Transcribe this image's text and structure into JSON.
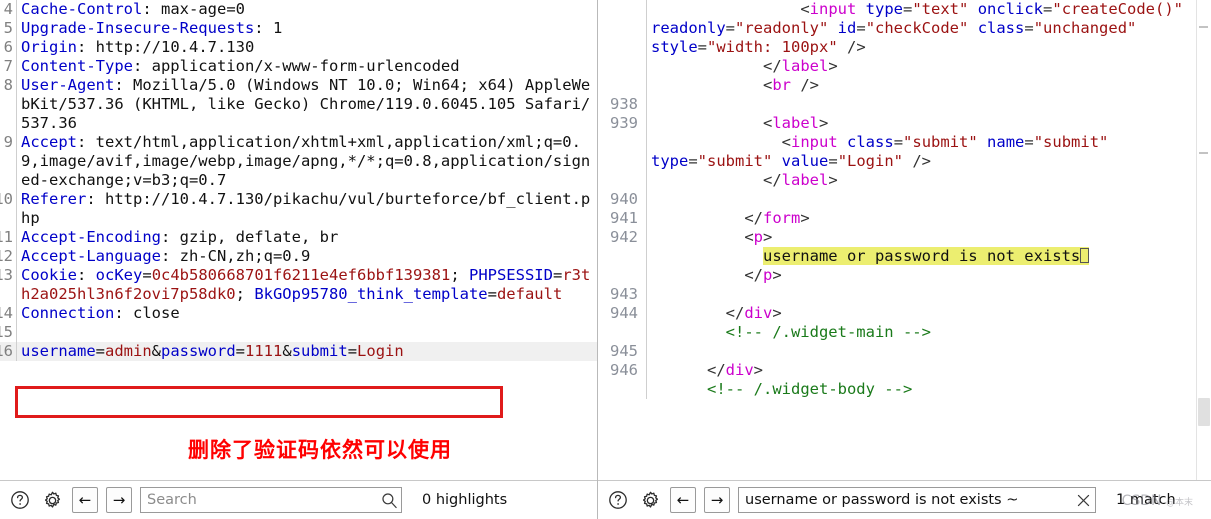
{
  "left_panel": {
    "name": "http-request-viewer",
    "lines": [
      {
        "num": "4",
        "segments": [
          {
            "t": "Cache-Control",
            "c": "k"
          },
          {
            "t": ": max-age=0",
            "c": "v"
          }
        ]
      },
      {
        "num": "5",
        "segments": [
          {
            "t": "Upgrade-Insecure-Requests",
            "c": "k"
          },
          {
            "t": ": 1",
            "c": "v"
          }
        ]
      },
      {
        "num": "6",
        "segments": [
          {
            "t": "Origin",
            "c": "k"
          },
          {
            "t": ": http://10.4.7.130",
            "c": "v"
          }
        ]
      },
      {
        "num": "7",
        "segments": [
          {
            "t": "Content-Type",
            "c": "k"
          },
          {
            "t": ": application/x-www-form-urlencoded",
            "c": "v"
          }
        ]
      },
      {
        "num": "8",
        "segments": [
          {
            "t": "User-Agent",
            "c": "k"
          },
          {
            "t": ": Mozilla/5.0 (Windows NT 10.0; Win64; x64) AppleWebKit/537.36 (KHTML, like Gecko) Chrome/119.0.6045.105 Safari/537.36",
            "c": "v"
          }
        ]
      },
      {
        "num": "9",
        "segments": [
          {
            "t": "Accept",
            "c": "k"
          },
          {
            "t": ": text/html,application/xhtml+xml,application/xml;q=0.9,image/avif,image/webp,image/apng,*/*;q=0.8,application/signed-exchange;v=b3;q=0.7",
            "c": "v"
          }
        ]
      },
      {
        "num": "10",
        "segments": [
          {
            "t": "Referer",
            "c": "k"
          },
          {
            "t": ": http://10.4.7.130/pikachu/vul/burteforce/bf_client.php",
            "c": "v"
          }
        ]
      },
      {
        "num": "11",
        "segments": [
          {
            "t": "Accept-Encoding",
            "c": "k"
          },
          {
            "t": ": gzip, deflate, br",
            "c": "v"
          }
        ]
      },
      {
        "num": "12",
        "segments": [
          {
            "t": "Accept-Language",
            "c": "k"
          },
          {
            "t": ": zh-CN,zh;q=0.9",
            "c": "v"
          }
        ]
      },
      {
        "num": "13",
        "segments": [
          {
            "t": "Cookie",
            "c": "k"
          },
          {
            "t": ": ",
            "c": "v"
          },
          {
            "t": "ocKey",
            "c": "k"
          },
          {
            "t": "=",
            "c": "v"
          },
          {
            "t": "0c4b580668701f6211e4ef6bbf139381",
            "c": "rv"
          },
          {
            "t": "; ",
            "c": "v"
          },
          {
            "t": "PHPSESSID",
            "c": "k"
          },
          {
            "t": "=",
            "c": "v"
          },
          {
            "t": "r3th2a025hl3n6f2ovi7p58dk0",
            "c": "rv"
          },
          {
            "t": "; ",
            "c": "v"
          },
          {
            "t": "BkGOp95780_think_template",
            "c": "k"
          },
          {
            "t": "=",
            "c": "v"
          },
          {
            "t": "default",
            "c": "rv"
          }
        ]
      },
      {
        "num": "14",
        "segments": [
          {
            "t": "Connection",
            "c": "k"
          },
          {
            "t": ": close",
            "c": "v"
          }
        ]
      },
      {
        "num": "15",
        "segments": [
          {
            "t": "",
            "c": "v"
          }
        ]
      },
      {
        "num": "16",
        "highlight": true,
        "segments": [
          {
            "t": "username",
            "c": "k"
          },
          {
            "t": "=",
            "c": "v"
          },
          {
            "t": "admin",
            "c": "rv"
          },
          {
            "t": "&",
            "c": "v"
          },
          {
            "t": "password",
            "c": "k"
          },
          {
            "t": "=",
            "c": "v"
          },
          {
            "t": "1111",
            "c": "rv"
          },
          {
            "t": "&",
            "c": "v"
          },
          {
            "t": "submit",
            "c": "k"
          },
          {
            "t": "=",
            "c": "v"
          },
          {
            "t": "Login",
            "c": "rv"
          }
        ]
      }
    ],
    "annotation": "删除了验证码依然可以使用",
    "annotation_color": "#ff0000",
    "redbox_color": "#e01b1b"
  },
  "right_panel": {
    "name": "http-response-viewer",
    "lines": [
      {
        "num": "",
        "segments": [
          {
            "t": "                ",
            "c": "punc"
          },
          {
            "t": "<",
            "c": "punc"
          },
          {
            "t": "input",
            "c": "tag"
          },
          {
            "t": " ",
            "c": "punc"
          },
          {
            "t": "type",
            "c": "attr"
          },
          {
            "t": "=",
            "c": "punc"
          },
          {
            "t": "\"text\"",
            "c": "str"
          },
          {
            "t": " ",
            "c": "punc"
          },
          {
            "t": "onclick",
            "c": "attr"
          },
          {
            "t": "=",
            "c": "punc"
          },
          {
            "t": "\"createCode()\"",
            "c": "str"
          },
          {
            "t": " ",
            "c": "punc"
          },
          {
            "t": "readonly",
            "c": "attr"
          },
          {
            "t": "=",
            "c": "punc"
          },
          {
            "t": "\"readonly\"",
            "c": "str"
          },
          {
            "t": " ",
            "c": "punc"
          },
          {
            "t": "id",
            "c": "attr"
          },
          {
            "t": "=",
            "c": "punc"
          },
          {
            "t": "\"checkCode\"",
            "c": "str"
          },
          {
            "t": " ",
            "c": "punc"
          },
          {
            "t": "class",
            "c": "attr"
          },
          {
            "t": "=",
            "c": "punc"
          },
          {
            "t": "\"unchanged\"",
            "c": "str"
          },
          {
            "t": " ",
            "c": "punc"
          },
          {
            "t": "style",
            "c": "attr"
          },
          {
            "t": "=",
            "c": "punc"
          },
          {
            "t": "\"width: 100px\"",
            "c": "str"
          },
          {
            "t": " />",
            "c": "punc"
          }
        ]
      },
      {
        "num": "",
        "segments": [
          {
            "t": "            ",
            "c": "punc"
          },
          {
            "t": "</",
            "c": "punc"
          },
          {
            "t": "label",
            "c": "tag"
          },
          {
            "t": ">",
            "c": "punc"
          }
        ]
      },
      {
        "num": "",
        "segments": [
          {
            "t": "            ",
            "c": "punc"
          },
          {
            "t": "<",
            "c": "punc"
          },
          {
            "t": "br",
            "c": "tag"
          },
          {
            "t": " />",
            "c": "punc"
          }
        ]
      },
      {
        "num": "938",
        "segments": [
          {
            "t": "",
            "c": "punc"
          }
        ]
      },
      {
        "num": "939",
        "segments": [
          {
            "t": "            ",
            "c": "punc"
          },
          {
            "t": "<",
            "c": "punc"
          },
          {
            "t": "label",
            "c": "tag"
          },
          {
            "t": ">",
            "c": "punc"
          }
        ]
      },
      {
        "num": "",
        "segments": [
          {
            "t": "              ",
            "c": "punc"
          },
          {
            "t": "<",
            "c": "punc"
          },
          {
            "t": "input",
            "c": "tag"
          },
          {
            "t": " ",
            "c": "punc"
          },
          {
            "t": "class",
            "c": "attr"
          },
          {
            "t": "=",
            "c": "punc"
          },
          {
            "t": "\"submit\"",
            "c": "str"
          },
          {
            "t": " ",
            "c": "punc"
          },
          {
            "t": "name",
            "c": "attr"
          },
          {
            "t": "=",
            "c": "punc"
          },
          {
            "t": "\"submit\"",
            "c": "str"
          },
          {
            "t": " ",
            "c": "punc"
          },
          {
            "t": "type",
            "c": "attr"
          },
          {
            "t": "=",
            "c": "punc"
          },
          {
            "t": "\"submit\"",
            "c": "str"
          },
          {
            "t": " ",
            "c": "punc"
          },
          {
            "t": "value",
            "c": "attr"
          },
          {
            "t": "=",
            "c": "punc"
          },
          {
            "t": "\"Login\"",
            "c": "str"
          },
          {
            "t": " />",
            "c": "punc"
          }
        ]
      },
      {
        "num": "",
        "segments": [
          {
            "t": "            ",
            "c": "punc"
          },
          {
            "t": "</",
            "c": "punc"
          },
          {
            "t": "label",
            "c": "tag"
          },
          {
            "t": ">",
            "c": "punc"
          }
        ]
      },
      {
        "num": "940",
        "segments": [
          {
            "t": "",
            "c": "punc"
          }
        ]
      },
      {
        "num": "941",
        "segments": [
          {
            "t": "          ",
            "c": "punc"
          },
          {
            "t": "</",
            "c": "punc"
          },
          {
            "t": "form",
            "c": "tag"
          },
          {
            "t": ">",
            "c": "punc"
          }
        ]
      },
      {
        "num": "942",
        "segments": [
          {
            "t": "          ",
            "c": "punc"
          },
          {
            "t": "<",
            "c": "punc"
          },
          {
            "t": "p",
            "c": "tag"
          },
          {
            "t": ">",
            "c": "punc"
          }
        ]
      },
      {
        "num": "",
        "segments": [
          {
            "t": "            ",
            "c": "punc"
          },
          {
            "t": "username or password is not exists",
            "c": "mark"
          },
          {
            "t": "\u0001",
            "c": "mark-tofu"
          }
        ]
      },
      {
        "num": "",
        "segments": [
          {
            "t": "          ",
            "c": "punc"
          },
          {
            "t": "</",
            "c": "punc"
          },
          {
            "t": "p",
            "c": "tag"
          },
          {
            "t": ">",
            "c": "punc"
          }
        ]
      },
      {
        "num": "943",
        "segments": [
          {
            "t": "",
            "c": "punc"
          }
        ]
      },
      {
        "num": "944",
        "segments": [
          {
            "t": "        ",
            "c": "punc"
          },
          {
            "t": "</",
            "c": "punc"
          },
          {
            "t": "div",
            "c": "tag"
          },
          {
            "t": ">",
            "c": "punc"
          }
        ]
      },
      {
        "num": "",
        "segments": [
          {
            "t": "        ",
            "c": "punc"
          },
          {
            "t": "<!-- /.widget-main -->",
            "c": "cmt"
          }
        ]
      },
      {
        "num": "945",
        "segments": [
          {
            "t": "",
            "c": "punc"
          }
        ]
      },
      {
        "num": "946",
        "segments": [
          {
            "t": "      ",
            "c": "punc"
          },
          {
            "t": "</",
            "c": "punc"
          },
          {
            "t": "div",
            "c": "tag"
          },
          {
            "t": ">",
            "c": "punc"
          }
        ]
      },
      {
        "num": "",
        "segments": [
          {
            "t": "      ",
            "c": "punc"
          },
          {
            "t": "<!-- /.widget-body -->",
            "c": "cmt"
          }
        ]
      }
    ],
    "highlight_color": "#ecee70"
  },
  "left_toolbar": {
    "help_icon": "question-circle-icon",
    "settings_icon": "gear-icon",
    "prev_label": "←",
    "next_label": "→",
    "search_value": "",
    "search_placeholder": "Search",
    "search_action_icon": "magnifier-icon",
    "status": "0 highlights"
  },
  "right_toolbar": {
    "help_icon": "question-circle-icon",
    "settings_icon": "gear-icon",
    "prev_label": "←",
    "next_label": "→",
    "search_value": "username or password is not exists ~",
    "search_placeholder": "Search",
    "search_action_icon": "clear-x-icon",
    "status": "1 match"
  },
  "watermark": {
    "main": "CSDN",
    "sub": "@本末"
  }
}
